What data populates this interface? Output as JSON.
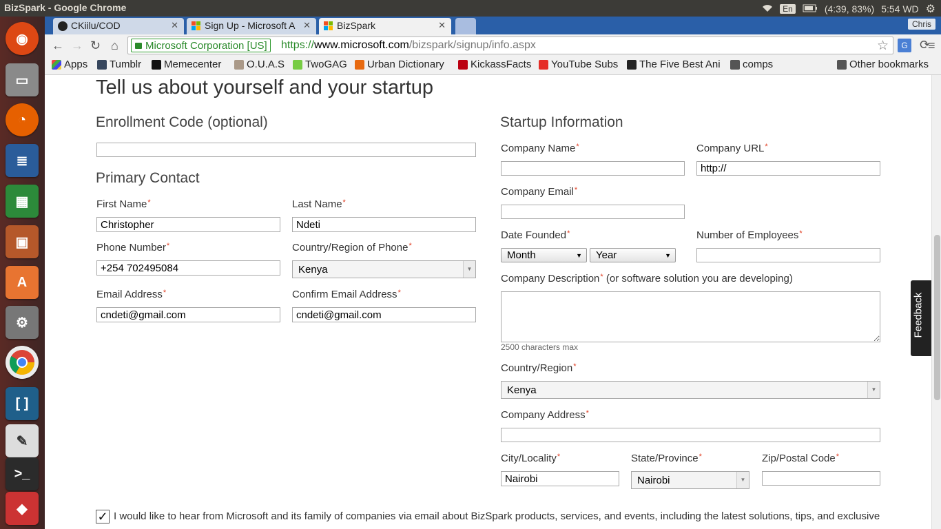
{
  "os": {
    "window_title": "BizSpark - Google Chrome",
    "language": "En",
    "battery": "(4:39, 83%)",
    "clock": "5:54 WD"
  },
  "browser": {
    "tabs": [
      {
        "label": "CKiilu/COD"
      },
      {
        "label": "Sign Up - Microsoft A"
      },
      {
        "label": "BizSpark"
      }
    ],
    "profile": "Chris",
    "ev_badge": "Microsoft Corporation [US]",
    "url_scheme": "https://",
    "url_host": "www.microsoft.com",
    "url_path": "/bizspark/signup/info.aspx",
    "bookmarks": [
      "Apps",
      "Tumblr",
      "Memecenter",
      "O.U.A.S",
      "TwoGAG",
      "Urban Dictionary",
      "KickassFacts",
      "YouTube Subs",
      "The Five Best Ani",
      "comps"
    ],
    "other_bookmarks": "Other bookmarks"
  },
  "page": {
    "heading": "Tell us about yourself and your startup",
    "enrollment": {
      "title": "Enrollment Code (optional)",
      "value": ""
    },
    "primary_contact": {
      "title": "Primary Contact",
      "first_name_label": "First Name",
      "first_name": "Christopher",
      "last_name_label": "Last Name",
      "last_name": "Ndeti",
      "phone_label": "Phone Number",
      "phone": "+254 702495084",
      "phone_country_label": "Country/Region of Phone",
      "phone_country": "Kenya",
      "email_label": "Email Address",
      "email": "cndeti@gmail.com",
      "confirm_email_label": "Confirm Email Address",
      "confirm_email": "cndeti@gmail.com"
    },
    "startup": {
      "title": "Startup Information",
      "company_name_label": "Company Name",
      "company_name": "",
      "company_url_label": "Company URL",
      "company_url": "http://",
      "company_email_label": "Company Email",
      "company_email": "",
      "date_founded_label": "Date Founded",
      "month": "Month",
      "year": "Year",
      "employees_label": "Number of Employees",
      "employees": "",
      "description_label": "Company Description",
      "description_hint": "(or software solution you are developing)",
      "description_max": "2500 characters max",
      "country_label": "Country/Region",
      "country": "Kenya",
      "address_label": "Company Address",
      "address": "",
      "city_label": "City/Locality",
      "city": "Nairobi",
      "state_label": "State/Province",
      "state": "Nairobi",
      "zip_label": "Zip/Postal Code",
      "zip": ""
    },
    "consent_text": "I would like to hear from Microsoft and its family of companies via email about BizSpark products, services, and events, including the latest solutions, tips, and exclusive",
    "feedback": "Feedback"
  },
  "colors": {
    "required": "#e03a1e",
    "tab_strip": "#2a5fa8",
    "ev_green": "#2a8a2a"
  }
}
